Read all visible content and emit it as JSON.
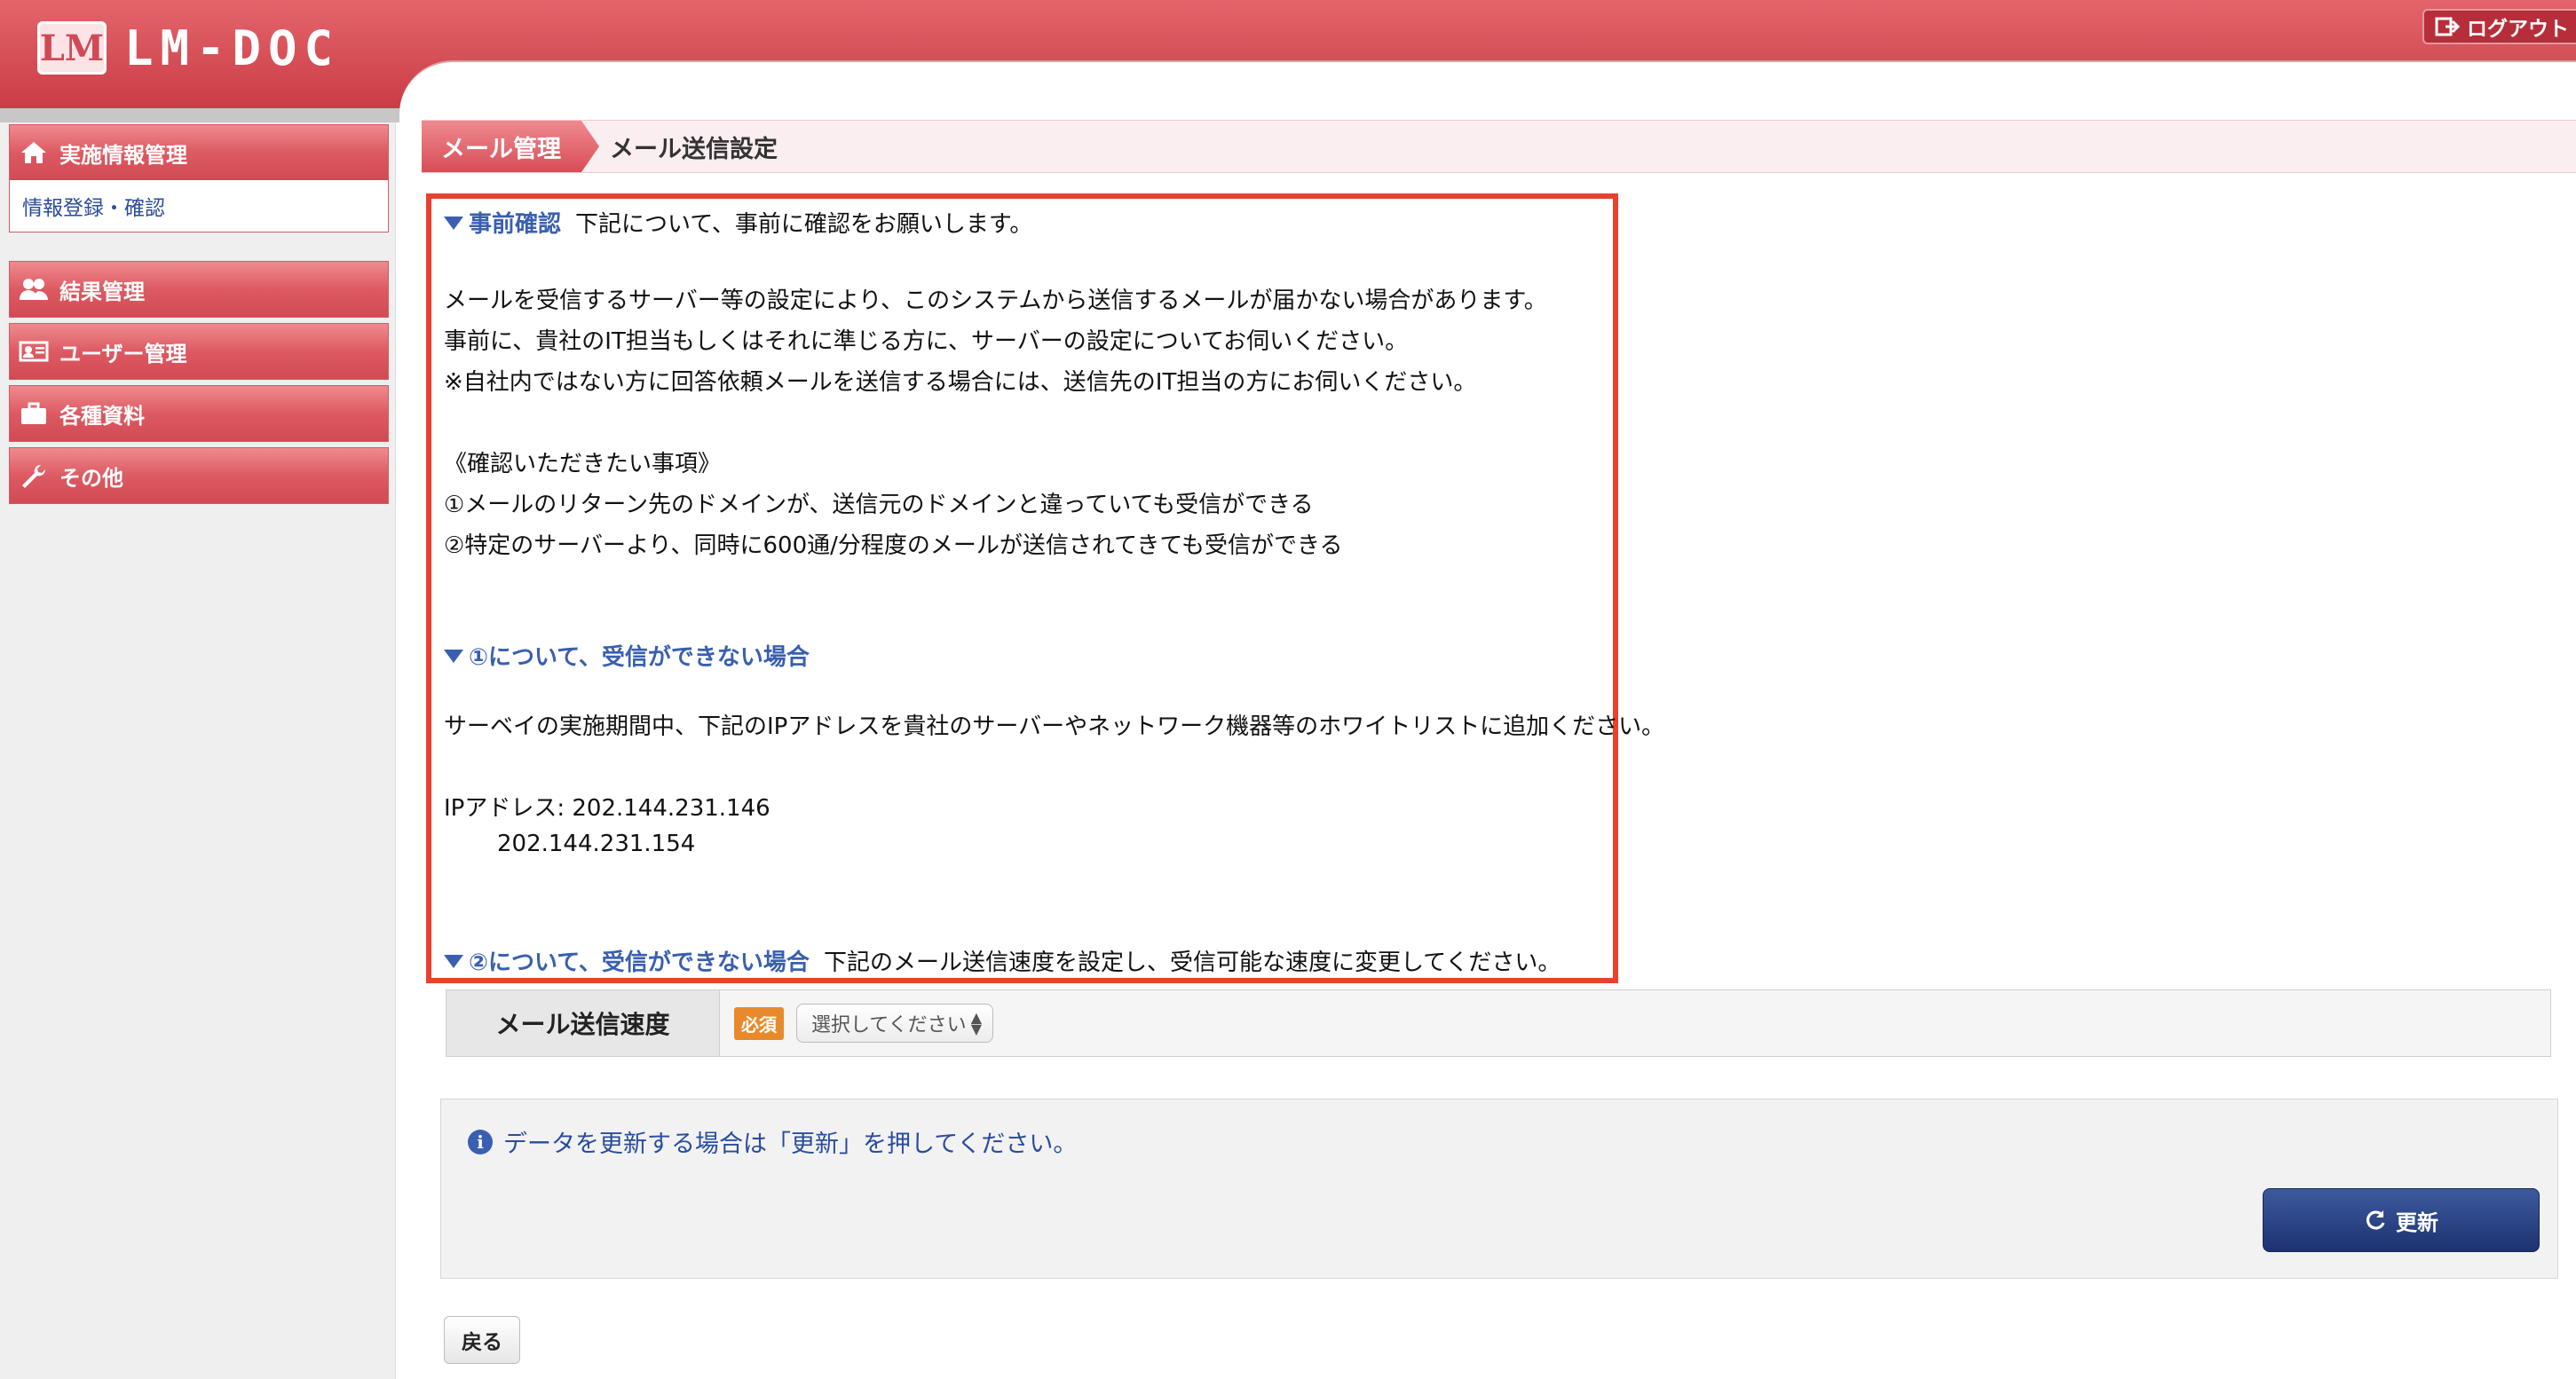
{
  "header": {
    "logo_mark": "LM",
    "logo_text": "LM-DOC",
    "logout_label": "ログアウト"
  },
  "sidebar": {
    "groups": [
      {
        "label": "実施情報管理",
        "icon": "home-icon",
        "sub": "情報登録・確認"
      },
      {
        "label": "結果管理",
        "icon": "users-icon"
      },
      {
        "label": "ユーザー管理",
        "icon": "id-card-icon"
      },
      {
        "label": "各種資料",
        "icon": "briefcase-icon"
      },
      {
        "label": "その他",
        "icon": "wrench-icon"
      }
    ]
  },
  "breadcrumb": {
    "parent": "メール管理",
    "current": "メール送信設定"
  },
  "notice": {
    "heading1": "事前確認",
    "heading1_text": "下記について、事前に確認をお願いします。",
    "p1": "メールを受信するサーバー等の設定により、このシステムから送信するメールが届かない場合があります。",
    "p2": "事前に、貴社のIT担当もしくはそれに準じる方に、サーバーの設定についてお伺いください。",
    "p3": "※自社内ではない方に回答依頼メールを送信する場合には、送信先のIT担当の方にお伺いください。",
    "checklist_title": "《確認いただきたい事項》",
    "item1": "①メールのリターン先のドメインが、送信元のドメインと違っていても受信ができる",
    "item2": "②特定のサーバーより、同時に600通/分程度のメールが送信されてきても受信ができる",
    "heading2": "①について、受信ができない場合",
    "p4": "サーベイの実施期間中、下記のIPアドレスを貴社のサーバーやネットワーク機器等のホワイトリストに追加ください。",
    "ip_label": "IPアドレス: 202.144.231.146",
    "ip2": "202.144.231.154",
    "heading3": "②について、受信ができない場合",
    "heading3_text": "下記のメール送信速度を設定し、受信可能な速度に変更してください。"
  },
  "form": {
    "label": "メール送信速度",
    "required_badge": "必須",
    "select_value": "選択してください"
  },
  "info": {
    "message": "データを更新する場合は「更新」を押してください。",
    "update_label": "更新"
  },
  "back_label": "戻る",
  "colors": {
    "brand_red": "#d24a53",
    "notice_border": "#e8412e",
    "link_blue": "#3a5fb0",
    "button_navy": "#1d3270",
    "required_orange": "#e88a2c"
  }
}
